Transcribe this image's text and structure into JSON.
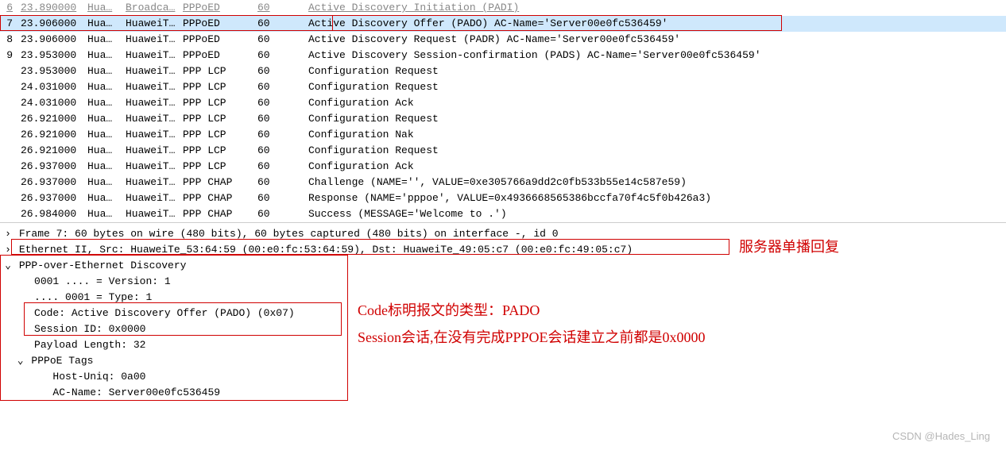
{
  "packets": [
    {
      "no": "6",
      "time": "23.890000",
      "src": "Hua…",
      "dst": "Broadca…",
      "proto": "PPPoED",
      "len": "60",
      "info": "Active Discovery Initiation (PADI)",
      "first": true
    },
    {
      "no": "7",
      "time": "23.906000",
      "src": "Hua…",
      "dst": "HuaweiT…",
      "proto": "PPPoED",
      "len": "60",
      "info": "Active Discovery Offer (PADO) AC-Name='Server00e0fc536459'",
      "selected": true
    },
    {
      "no": "8",
      "time": "23.906000",
      "src": "Hua…",
      "dst": "HuaweiT…",
      "proto": "PPPoED",
      "len": "60",
      "info": "Active Discovery Request (PADR) AC-Name='Server00e0fc536459'"
    },
    {
      "no": "9",
      "time": "23.953000",
      "src": "Hua…",
      "dst": "HuaweiT…",
      "proto": "PPPoED",
      "len": "60",
      "info": "Active Discovery Session-confirmation (PADS) AC-Name='Server00e0fc536459'"
    },
    {
      "no": "",
      "time": "23.953000",
      "src": "Hua…",
      "dst": "HuaweiT…",
      "proto": "PPP LCP",
      "len": "60",
      "info": "Configuration Request"
    },
    {
      "no": "",
      "time": "24.031000",
      "src": "Hua…",
      "dst": "HuaweiT…",
      "proto": "PPP LCP",
      "len": "60",
      "info": "Configuration Request"
    },
    {
      "no": "",
      "time": "24.031000",
      "src": "Hua…",
      "dst": "HuaweiT…",
      "proto": "PPP LCP",
      "len": "60",
      "info": "Configuration Ack"
    },
    {
      "no": "",
      "time": "26.921000",
      "src": "Hua…",
      "dst": "HuaweiT…",
      "proto": "PPP LCP",
      "len": "60",
      "info": "Configuration Request"
    },
    {
      "no": "",
      "time": "26.921000",
      "src": "Hua…",
      "dst": "HuaweiT…",
      "proto": "PPP LCP",
      "len": "60",
      "info": "Configuration Nak"
    },
    {
      "no": "",
      "time": "26.921000",
      "src": "Hua…",
      "dst": "HuaweiT…",
      "proto": "PPP LCP",
      "len": "60",
      "info": "Configuration Request"
    },
    {
      "no": "",
      "time": "26.937000",
      "src": "Hua…",
      "dst": "HuaweiT…",
      "proto": "PPP LCP",
      "len": "60",
      "info": "Configuration Ack"
    },
    {
      "no": "",
      "time": "26.937000",
      "src": "Hua…",
      "dst": "HuaweiT…",
      "proto": "PPP CHAP",
      "len": "60",
      "info": "Challenge (NAME='', VALUE=0xe305766a9dd2c0fb533b55e14c587e59)"
    },
    {
      "no": "",
      "time": "26.937000",
      "src": "Hua…",
      "dst": "HuaweiT…",
      "proto": "PPP CHAP",
      "len": "60",
      "info": "Response (NAME='pppoe', VALUE=0x4936668565386bccfa70f4c5f0b426a3)"
    },
    {
      "no": "",
      "time": "26.984000",
      "src": "Hua…",
      "dst": "HuaweiT…",
      "proto": "PPP CHAP",
      "len": "60",
      "info": "Success (MESSAGE='Welcome to .')"
    }
  ],
  "details": {
    "frame": "Frame 7: 60 bytes on wire (480 bits), 60 bytes captured (480 bits) on interface -, id 0",
    "eth": "Ethernet II, Src: HuaweiTe_53:64:59 (00:e0:fc:53:64:59), Dst: HuaweiTe_49:05:c7 (00:e0:fc:49:05:c7)",
    "pppoe_hdr": "PPP-over-Ethernet Discovery",
    "version": "0001 .... = Version: 1",
    "type": ".... 0001 = Type: 1",
    "code": "Code: Active Discovery Offer (PADO) (0x07)",
    "session": "Session ID: 0x0000",
    "payload": "Payload Length: 32",
    "tags_hdr": "PPPoE Tags",
    "tag1": "Host-Uniq: 0a00",
    "tag2": "AC-Name: Server00e0fc536459"
  },
  "annotations": {
    "a1": "服务器单播回复",
    "a2": "Code标明报文的类型：PADO",
    "a3": "Session会话,在没有完成PPPOE会话建立之前都是0x0000"
  },
  "watermark": "CSDN @Hades_Ling"
}
